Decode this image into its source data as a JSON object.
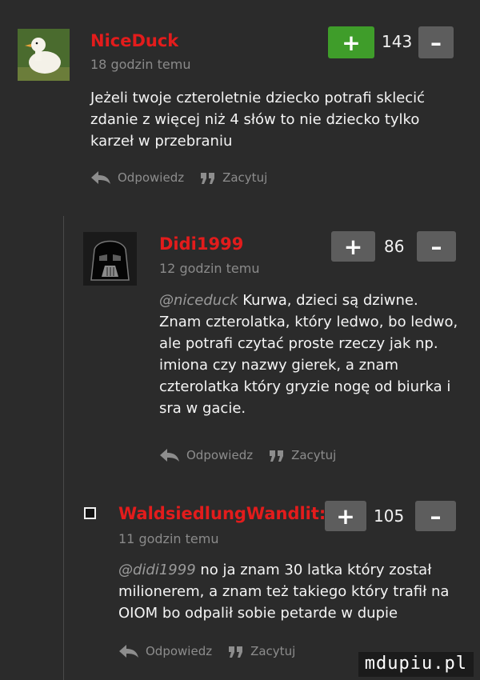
{
  "comments": [
    {
      "username": "NiceDuck",
      "time": "18 godzin temu",
      "score": "143",
      "plus_label": "+",
      "minus_label": "–",
      "plus_active": true,
      "text": "Jeżeli twoje czteroletnie dziecko potrafi sklecić zdanie z więcej niż 4 słów to nie dziecko tylko karzeł w przebraniu",
      "reply_label": "Odpowiedz",
      "quote_label": "Zacytuj",
      "avatar_icon": "duck-avatar"
    },
    {
      "username": "Didi1999",
      "time": "12 godzin temu",
      "score": "86",
      "plus_label": "+",
      "minus_label": "–",
      "plus_active": false,
      "mention": "@niceduck",
      "text": " Kurwa, dzieci są dziwne. Znam czterolatka, który ledwo, bo ledwo, ale potrafi czytać proste rzeczy jak np. imiona czy nazwy gierek, a znam czterolatka który gryzie nogę od biurka i sra w gacie.",
      "reply_label": "Odpowiedz",
      "quote_label": "Zacytuj",
      "avatar_icon": "helmet-avatar"
    },
    {
      "username": "WaldsiedlungWandlit:",
      "time": "11 godzin temu",
      "score": "105",
      "plus_label": "+",
      "minus_label": "–",
      "plus_active": false,
      "mention": "@didi1999",
      "text": " no ja znam 30 latka który został milionerem, a znam też takiego który trafił na OIOM bo odpalił sobie petarde w dupie",
      "reply_label": "Odpowiedz",
      "quote_label": "Zacytuj",
      "avatar_icon": "square-avatar"
    }
  ],
  "watermark": "mdupiu.pl",
  "colors": {
    "username": "#e31c1c",
    "plus_active": "#3f9d2a",
    "button": "#5d5d5d",
    "background": "#2b2b2b"
  }
}
